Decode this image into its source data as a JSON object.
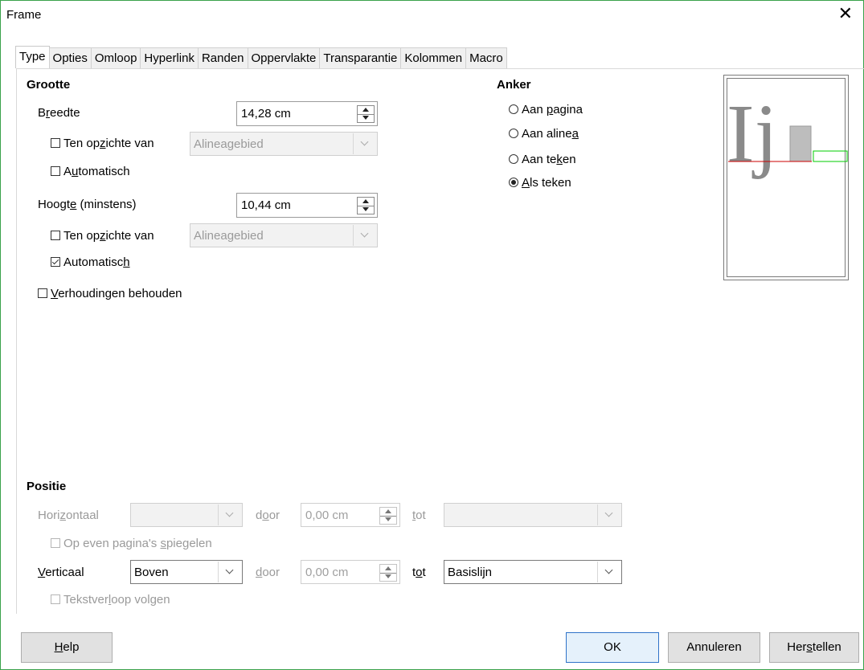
{
  "window": {
    "title": "Frame"
  },
  "tabs": [
    "Type",
    "Opties",
    "Omloop",
    "Hyperlink",
    "Randen",
    "Oppervlakte",
    "Transparantie",
    "Kolommen",
    "Macro"
  ],
  "size": {
    "heading": "Grootte",
    "width": {
      "label_pre": "B",
      "label_ul": "r",
      "label_post": "eedte",
      "value": "14,28 cm",
      "relative": {
        "pre": "Ten op",
        "ul": "z",
        "post": "ichte van",
        "checked": false
      },
      "relative_value": "Alineagebied",
      "auto": {
        "pre": "A",
        "ul": "u",
        "post": "tomatisch",
        "checked": false
      }
    },
    "height": {
      "label_pre": "Hoogt",
      "label_ul": "e",
      "label_post": " (minstens)",
      "value": "10,44 cm",
      "relative": {
        "pre": "Ten op",
        "ul": "z",
        "post": "ichte van",
        "checked": false
      },
      "relative_value": "Alineagebied",
      "auto": {
        "pre": "Automatisc",
        "ul": "h",
        "post": "",
        "checked": true
      }
    },
    "keep_ratio": {
      "pre": "",
      "ul": "V",
      "post": "erhoudingen behouden",
      "checked": false
    }
  },
  "anchor": {
    "heading": "Anker",
    "options": [
      {
        "pre": "Aan ",
        "ul": "p",
        "post": "agina",
        "selected": false
      },
      {
        "pre": "Aan aline",
        "ul": "a",
        "post": "",
        "selected": false
      },
      {
        "pre": "Aan te",
        "ul": "k",
        "post": "en",
        "selected": false
      },
      {
        "pre": "",
        "ul": "A",
        "post": "ls teken",
        "selected": true
      }
    ]
  },
  "preview": {
    "glyphs": "Ij",
    "accent": "#cc0000",
    "frame": "#00cc00"
  },
  "position": {
    "heading": "Positie",
    "horizontal": {
      "label_pre": "Hori",
      "label_ul": "z",
      "label_post": "ontaal",
      "value": "",
      "by_pre": "d",
      "by_ul": "o",
      "by_post": "or",
      "by_value": "0,00 cm",
      "to_pre": "",
      "to_ul": "t",
      "to_post": "ot",
      "to_value": ""
    },
    "mirror": {
      "pre": "Op even pagina's ",
      "ul": "s",
      "post": "piegelen"
    },
    "vertical": {
      "label_pre": "",
      "label_ul": "V",
      "label_post": "erticaal",
      "value": "Boven",
      "by_pre": "",
      "by_ul": "d",
      "by_post": "oor",
      "by_value": "0,00 cm",
      "to_pre": "t",
      "to_ul": "o",
      "to_post": "t",
      "to_value": "Basislijn"
    },
    "follow": {
      "pre": "Tekstver",
      "ul": "l",
      "post": "oop volgen"
    }
  },
  "buttons": {
    "help": {
      "pre": "",
      "ul": "H",
      "post": "elp"
    },
    "ok": "OK",
    "cancel": "Annuleren",
    "reset": {
      "pre": "Her",
      "ul": "s",
      "post": "tellen"
    }
  }
}
